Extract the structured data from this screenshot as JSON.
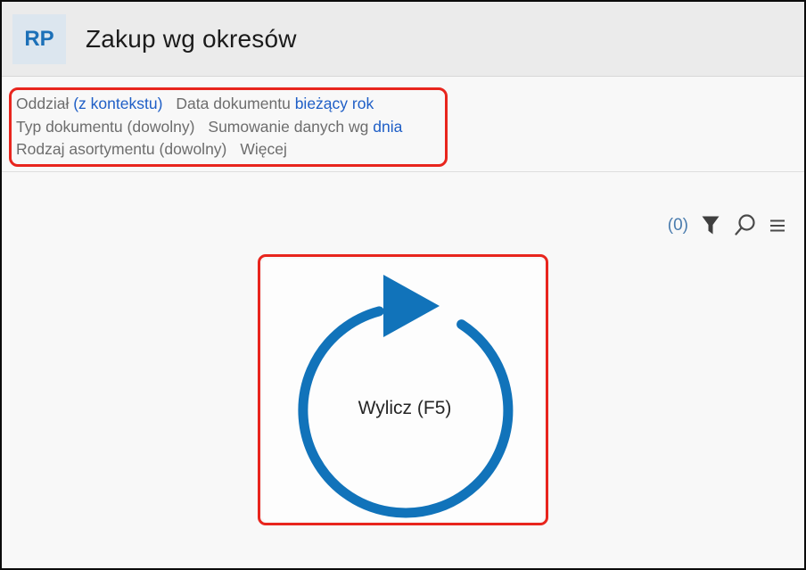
{
  "colors": {
    "accent_blue": "#1173ba",
    "link_blue": "#1e5ec6",
    "annotation_red": "#e8251d",
    "header_bg": "#ebebeb",
    "content_bg": "#f8f8f8",
    "badge_bg": "#dce6ef",
    "badge_text": "#1c70b8",
    "muted_text": "#6d6d6d",
    "filter_count_text": "#4a7cae",
    "icon_gray": "#404040"
  },
  "header": {
    "app_badge": "RP",
    "title": "Zakup wg okresów"
  },
  "filter_bar": {
    "rows": [
      {
        "items": [
          {
            "label": "Oddział",
            "value": "(z kontekstu)"
          },
          {
            "label": "Data dokumentu",
            "value": "bieżący rok"
          }
        ]
      },
      {
        "items": [
          {
            "label": "Typ dokumentu",
            "value": "(dowolny)"
          },
          {
            "label": "Sumowanie danych wg",
            "value": "dnia"
          }
        ]
      },
      {
        "items": [
          {
            "label": "Rodzaj asortymentu",
            "value": "(dowolny)"
          },
          {
            "label": "Więcej",
            "value": ""
          }
        ]
      }
    ],
    "filter_count": "(0)",
    "icons": [
      "filter-funnel",
      "search",
      "menu"
    ]
  },
  "main": {
    "calculate_button": {
      "label": "Wylicz (F5)",
      "icon": "refresh-run"
    }
  }
}
